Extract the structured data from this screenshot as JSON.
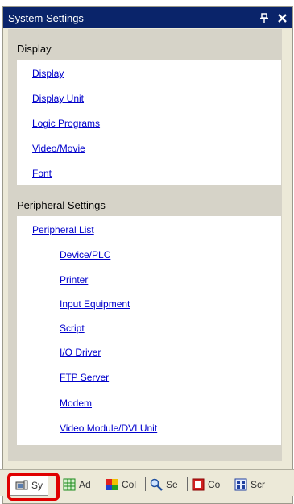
{
  "window": {
    "title": "System Settings"
  },
  "sections": [
    {
      "header": "Display",
      "items": [
        {
          "label": "Display"
        },
        {
          "label": "Display Unit"
        },
        {
          "label": "Logic Programs"
        },
        {
          "label": "Video/Movie"
        },
        {
          "label": "Font"
        }
      ]
    },
    {
      "header": "Peripheral Settings",
      "items": [
        {
          "label": "Peripheral List"
        },
        {
          "label": "Device/PLC"
        },
        {
          "label": "Printer"
        },
        {
          "label": "Input Equipment"
        },
        {
          "label": "Script"
        },
        {
          "label": "I/O Driver"
        },
        {
          "label": "FTP Server"
        },
        {
          "label": "Modem"
        },
        {
          "label": "Video Module/DVI Unit"
        }
      ]
    }
  ],
  "tabs": [
    {
      "label": "Sy",
      "icon": "system-settings-icon",
      "active": true
    },
    {
      "label": "Ad",
      "icon": "address-grid-icon"
    },
    {
      "label": "Col",
      "icon": "color-palette-icon"
    },
    {
      "label": "Se",
      "icon": "search-icon"
    },
    {
      "label": "Co",
      "icon": "component-icon"
    },
    {
      "label": "Scr",
      "icon": "screen-list-icon"
    }
  ],
  "colors": {
    "title_bar": "#0a246a",
    "link": "#0000cc",
    "highlight": "#e00000"
  }
}
